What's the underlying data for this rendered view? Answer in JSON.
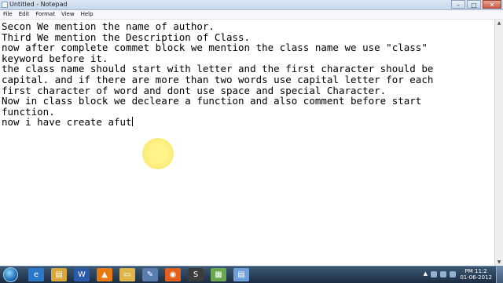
{
  "window": {
    "title": "Untitled - Notepad",
    "controls": [
      "–",
      "□",
      "✕"
    ]
  },
  "menu": [
    "File",
    "Edit",
    "Format",
    "View",
    "Help"
  ],
  "editor": {
    "lines": [
      "Secon We mention the name of author.",
      "Third We mention the Description of Class.",
      "now after complete commet block we mention the class name we use \"class\"",
      "keyword before it.",
      "the class name should start with letter and the first character should be",
      "capital. and if there are more than two words use capital letter for each",
      "first character of word and dont use space and special Character.",
      "Now in class block we decleare a function and also comment before start",
      "function.",
      "now i have create afut"
    ]
  },
  "taskbar": {
    "apps": [
      {
        "name": "internet-explorer",
        "glyph": "e",
        "color": "#2b78c8"
      },
      {
        "name": "file-explorer",
        "glyph": "▤",
        "color": "#d8a93a"
      },
      {
        "name": "word",
        "glyph": "W",
        "color": "#2a5aa8"
      },
      {
        "name": "vlc",
        "glyph": "▲",
        "color": "#e87a14"
      },
      {
        "name": "folder",
        "glyph": "▭",
        "color": "#e0b64a"
      },
      {
        "name": "paint",
        "glyph": "✎",
        "color": "#5a7db0"
      },
      {
        "name": "firefox",
        "glyph": "◉",
        "color": "#e4601a"
      },
      {
        "name": "sublime",
        "glyph": "S",
        "color": "#3c3c3c"
      },
      {
        "name": "app-grid",
        "glyph": "▦",
        "color": "#6aa84f"
      },
      {
        "name": "notepad",
        "glyph": "▤",
        "color": "#6f9fd8"
      }
    ],
    "clock_time": "PM 11:2",
    "clock_date": "01-06-2012"
  }
}
